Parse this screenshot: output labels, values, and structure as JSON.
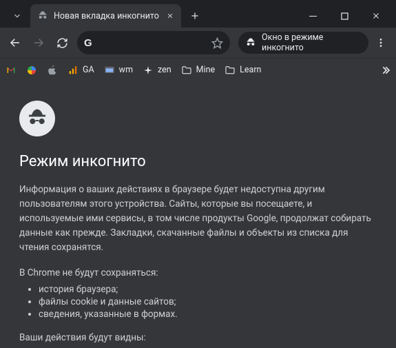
{
  "tab": {
    "title": "Новая вкладка инкогнито"
  },
  "chip": {
    "label": "Окно в режиме инкогнито"
  },
  "bookmarks": {
    "ga": "GA",
    "wm": "wm",
    "zen": "zen",
    "mine": "Mine",
    "learn": "Learn"
  },
  "page": {
    "heading": "Режим инкогнито",
    "paragraph": "Информация о ваших действиях в браузере будет недоступна другим пользователям этого устройства. Сайты, которые вы посещаете, и используемые ими сервисы, в том числе продукты Google, продолжат собирать данные как прежде. Закладки, скачанные файлы и объекты из списка для чтения сохранятся.",
    "not_saved_label": "В Chrome не будут сохраняться:",
    "not_saved": [
      "история браузера;",
      "файлы cookie и данные сайтов;",
      "сведения, указанные в формах."
    ],
    "visible_label": "Ваши действия будут видны:"
  }
}
